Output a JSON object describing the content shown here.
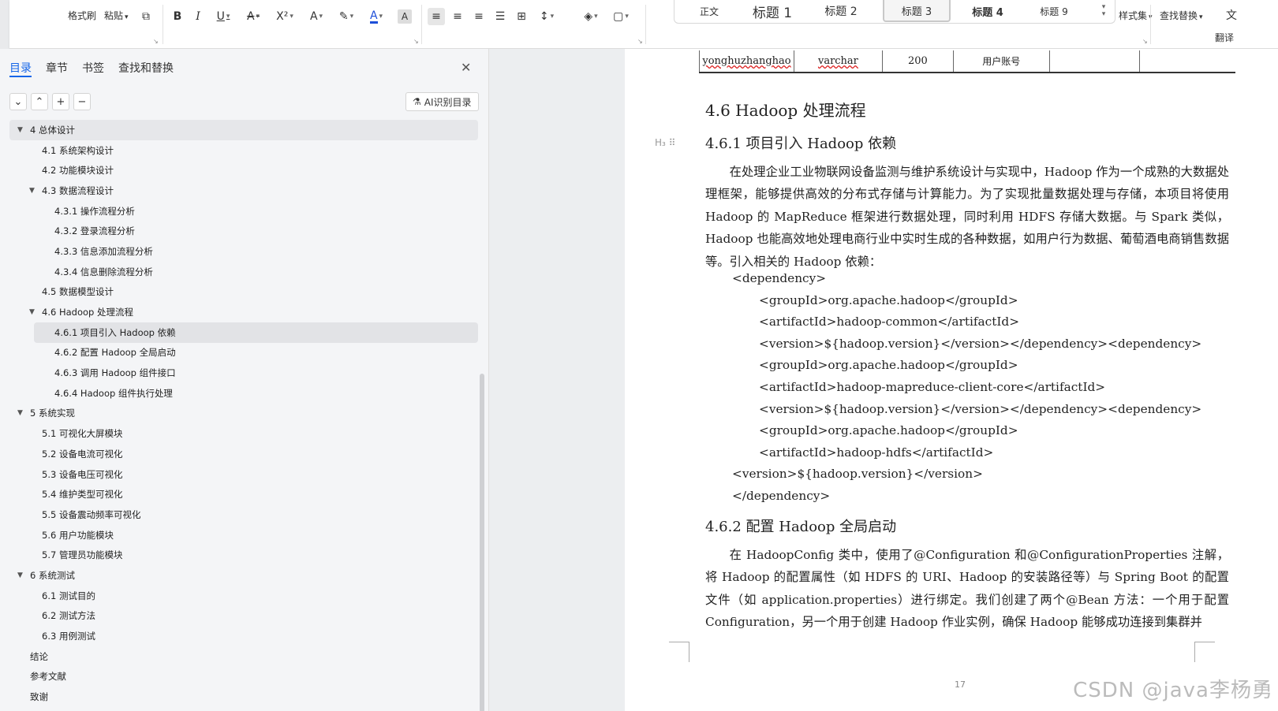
{
  "ribbon": {
    "format_painter": "格式刷",
    "paste": "粘贴",
    "find_replace": "查找替换",
    "style_set": "样式集",
    "translate": "翻译",
    "styles": [
      "正文",
      "标题 1",
      "标题 2",
      "标题 3",
      "标题 4",
      "标题 9"
    ],
    "selected_style": "标题 3"
  },
  "nav": {
    "tabs": [
      "目录",
      "章节",
      "书签",
      "查找和替换"
    ],
    "active_tab": "目录",
    "ai_button": "AI识别目录",
    "toc": [
      {
        "text": "4 总体设计",
        "level": 1,
        "expanded": true,
        "highlight": "light"
      },
      {
        "text": "4.1 系统架构设计",
        "level": 2
      },
      {
        "text": "4.2 功能模块设计",
        "level": 2
      },
      {
        "text": "4.3 数据流程设计",
        "level": 2,
        "expanded": true
      },
      {
        "text": "4.3.1 操作流程分析",
        "level": 3
      },
      {
        "text": "4.3.2 登录流程分析",
        "level": 3
      },
      {
        "text": "4.3.3 信息添加流程分析",
        "level": 3
      },
      {
        "text": "4.3.4 信息删除流程分析",
        "level": 3
      },
      {
        "text": "4.5  数据模型设计",
        "level": 2
      },
      {
        "text": "4.6 Hadoop 处理流程",
        "level": 2,
        "expanded": true
      },
      {
        "text": "4.6.1  项目引入 Hadoop 依赖",
        "level": 3,
        "highlight": "strong"
      },
      {
        "text": "4.6.2  配置 Hadoop 全局启动",
        "level": 3
      },
      {
        "text": "4.6.3  调用 Hadoop 组件接口",
        "level": 3
      },
      {
        "text": "4.6.4 Hadoop 组件执行处理",
        "level": 3
      },
      {
        "text": "5 系统实现",
        "level": 1,
        "expanded": true
      },
      {
        "text": "5.1  可视化大屏模块",
        "level": 2
      },
      {
        "text": "5.2  设备电流可视化",
        "level": 2
      },
      {
        "text": "5.3  设备电压可视化",
        "level": 2
      },
      {
        "text": "5.4  维护类型可视化",
        "level": 2
      },
      {
        "text": "5.5  设备震动频率可视化",
        "level": 2
      },
      {
        "text": "5.6  用户功能模块",
        "level": 2
      },
      {
        "text": "5.7  管理员功能模块",
        "level": 2
      },
      {
        "text": "6 系统测试",
        "level": 1,
        "expanded": true
      },
      {
        "text": "6.1  测试目的",
        "level": 2
      },
      {
        "text": "6.2  测试方法",
        "level": 2
      },
      {
        "text": "6.3  用例测试",
        "level": 2
      },
      {
        "text": "结论",
        "level": 1
      },
      {
        "text": "参考文献",
        "level": 1
      },
      {
        "text": "致谢",
        "level": 1
      }
    ]
  },
  "doc": {
    "table_row": [
      "yonghuzhanghao",
      "varchar",
      "200",
      "用户账号",
      ""
    ],
    "h_4_6": "4.6 Hadoop 处理流程",
    "h_4_6_1": "4.6.1  项目引入 Hadoop 依赖",
    "h_marker": "H₃ ⠿",
    "para1": "在处理企业工业物联网设备监测与维护系统设计与实现中，Hadoop 作为一个成熟的大数据处理框架，能够提供高效的分布式存储与计算能力。为了实现批量数据处理与存储，本项目将使用 Hadoop 的 MapReduce 框架进行数据处理，同时利用 HDFS 存储大数据。与 Spark 类似，Hadoop 也能高效地处理电商行业中实时生成的各种数据，如用户行为数据、葡萄酒电商销售数据等。引入相关的 Hadoop 依赖：",
    "code": [
      {
        "indent": 1,
        "text": "<dependency>"
      },
      {
        "indent": 2,
        "text": "<groupId>org.apache.hadoop</groupId>"
      },
      {
        "indent": 2,
        "text": "<artifactId>hadoop-common</artifactId>"
      },
      {
        "indent": 2,
        "text": "<version>${hadoop.version}</version></dependency><dependency>"
      },
      {
        "indent": 2,
        "text": "<groupId>org.apache.hadoop</groupId>"
      },
      {
        "indent": 2,
        "text": "<artifactId>hadoop-mapreduce-client-core</artifactId>"
      },
      {
        "indent": 2,
        "text": "<version>${hadoop.version}</version></dependency><dependency>"
      },
      {
        "indent": 2,
        "text": "<groupId>org.apache.hadoop</groupId>"
      },
      {
        "indent": 2,
        "text": "<artifactId>hadoop-hdfs</artifactId>"
      },
      {
        "indent": 1,
        "text": "<version>${hadoop.version}</version>"
      },
      {
        "indent": 1,
        "text": "</dependency>"
      }
    ],
    "h_4_6_2": "4.6.2  配置 Hadoop 全局启动",
    "para2": "在 HadoopConfig 类中，使用了@Configuration 和@ConfigurationProperties 注解，将 Hadoop 的配置属性（如 HDFS 的 URI、Hadoop 的安装路径等）与 Spring Boot 的配置文件（如 application.properties）进行绑定。我们创建了两个@Bean 方法：一个用于配置 Configuration，另一个用于创建 Hadoop 作业实例，确保 Hadoop 能够成功连接到集群并",
    "page_number": "17",
    "watermark": "CSDN @java李杨勇"
  }
}
